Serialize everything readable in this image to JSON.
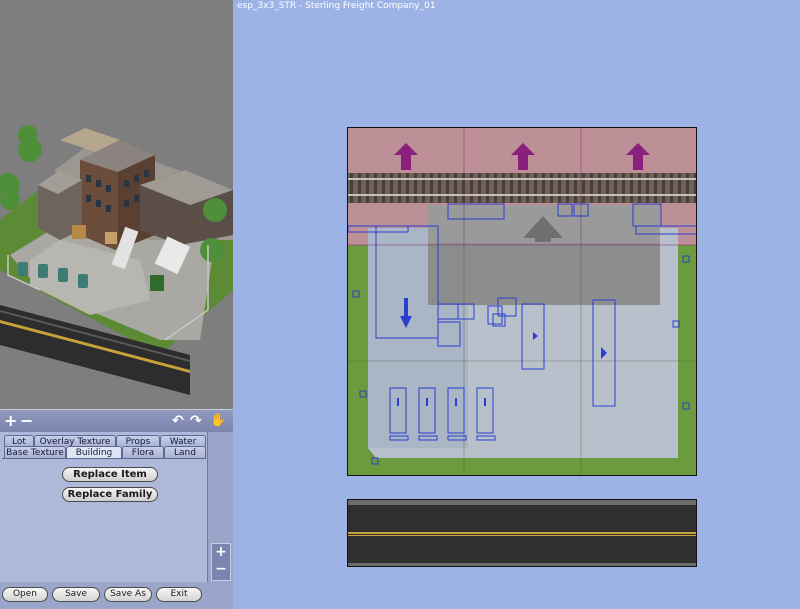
{
  "window": {
    "title": "esp_3x3_STR - Sterling Freight Company_01"
  },
  "toolbar": {
    "add": "+",
    "remove": "−",
    "rotate_left": "↶",
    "rotate_right": "↷",
    "hand": "✋"
  },
  "tabs": {
    "row1": [
      {
        "label": "Lot"
      },
      {
        "label": "Overlay Texture"
      },
      {
        "label": "Props"
      },
      {
        "label": "Water"
      }
    ],
    "row2": [
      {
        "label": "Base Texture"
      },
      {
        "label": "Building"
      },
      {
        "label": "Flora"
      },
      {
        "label": "Land"
      }
    ],
    "active": "Building"
  },
  "building": {
    "replace_item": "Replace Item",
    "replace_family": "Replace Family"
  },
  "zoom": {
    "in": "+",
    "out": "−"
  },
  "footer": {
    "open": "Open",
    "save": "Save",
    "save_as": "Save As",
    "exit": "Exit"
  },
  "colors": {
    "background": "#9db3e6",
    "panel": "#9aa6c9",
    "footprint_outline": "#2a3fd0",
    "zone_arrow": "#8a1f7e",
    "building_footprint": "#8a8a8a"
  },
  "icons": {
    "add": "plus-icon",
    "remove": "minus-icon",
    "rotate_left": "rotate-left-icon",
    "rotate_right": "rotate-right-icon",
    "hand": "hand-icon",
    "arrows": "arrow-up-icon"
  }
}
